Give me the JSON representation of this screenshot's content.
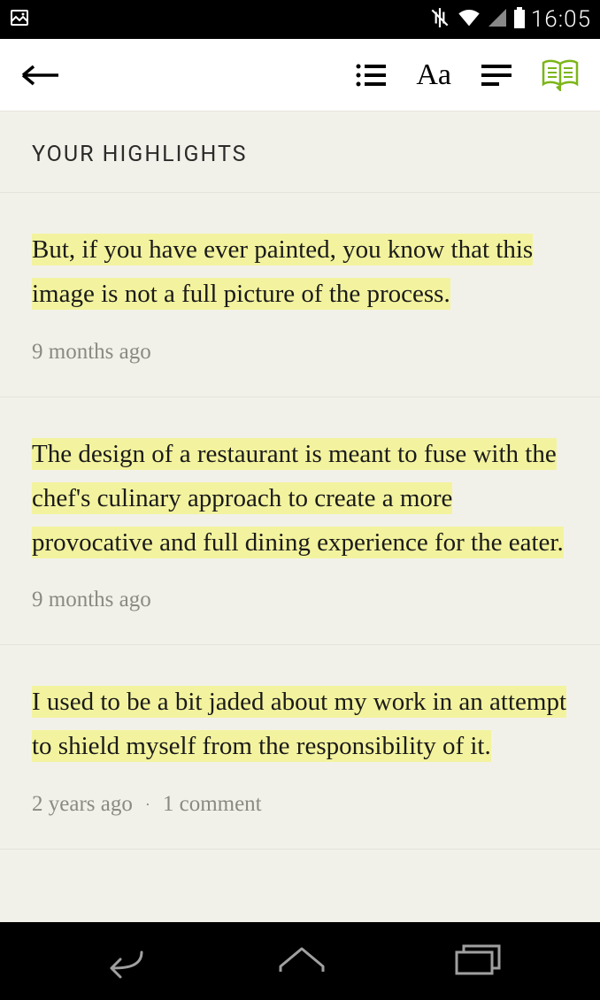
{
  "status": {
    "time": "16:05"
  },
  "section": {
    "title": "YOUR HIGHLIGHTS"
  },
  "highlights": [
    {
      "text": "But, if you have ever painted, you know that this image is not a full picture of the process.",
      "time": "9 months ago",
      "comments": ""
    },
    {
      "text": "The design of a restaurant is meant to fuse with the chef's culinary approach to create a more provocative and full dining experience for the eater.",
      "time": "9 months ago",
      "comments": ""
    },
    {
      "text": "I used to be a bit jaded about my work in an attempt to shield myself from the responsibility of it.",
      "time": "2 years ago",
      "comments": "1 comment"
    }
  ]
}
